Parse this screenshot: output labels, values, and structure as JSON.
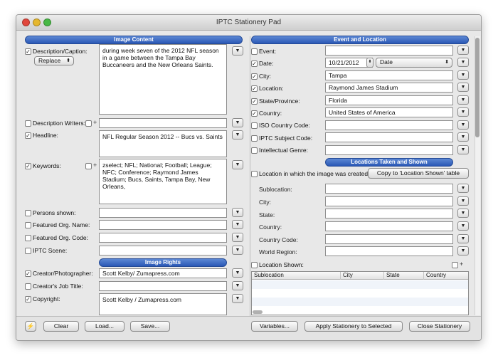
{
  "window": {
    "title": "IPTC Stationery Pad"
  },
  "left": {
    "image_content_header": "Image Content",
    "description_label": "Description/Caption:",
    "replace_popup": "Replace",
    "description_value": "during week seven of the 2012 NFL season in a game between the Tampa Bay Buccaneers and the New Orleans Saints.",
    "description_writers_label": "Description Writers:",
    "headline_label": "Headline:",
    "headline_value": "NFL Regular Season 2012 -- Bucs vs. Saints",
    "keywords_label": "Keywords:",
    "keywords_value": "zselect; NFL; National; Football; League; NFC; Conference; Raymond James Stadium; Bucs, Saints, Tampa Bay, New Orleans,",
    "persons_label": "Persons shown:",
    "featured_org_name_label": "Featured Org. Name:",
    "featured_org_code_label": "Featured Org. Code:",
    "iptc_scene_label": "IPTC Scene:",
    "image_rights_header": "Image Rights",
    "creator_label": "Creator/Photographer:",
    "creator_value": "Scott Kelby/ Zumapress.com",
    "creators_job_label": "Creator's Job Title:",
    "copyright_label": "Copyright:",
    "copyright_value": "Scott Kelby / Zumapress.com",
    "plus_sign": "+"
  },
  "right": {
    "event_header": "Event and Location",
    "event_label": "Event:",
    "date_label": "Date:",
    "date_value": "10/21/2012",
    "date_popup": "Date",
    "city_label": "City:",
    "city_value": "Tampa",
    "location_label": "Location:",
    "location_value": "Raymond James Stadium",
    "state_label": "State/Province:",
    "state_value": "Florida",
    "country_label": "Country:",
    "country_value": "United States of America",
    "iso_label": "ISO Country Code:",
    "subject_code_label": "IPTC Subject Code:",
    "genre_label": "Intellectual Genre:",
    "locations_header": "Locations Taken and Shown",
    "location_created_label": "Location in which the image was created:",
    "copy_button": "Copy to 'Location Shown' table",
    "sublocation_label": "Sublocation:",
    "city2_label": "City:",
    "state2_label": "State:",
    "country2_label": "Country:",
    "country_code_label": "Country Code:",
    "world_region_label": "World Region:",
    "location_shown_label": "Location Shown:",
    "plus_sign": "+",
    "table_columns": [
      "Sublocation",
      "City",
      "State",
      "Country"
    ]
  },
  "bottom": {
    "lightning_glyph": "⚡",
    "clear": "Clear",
    "load": "Load...",
    "save": "Save...",
    "variables": "Variables...",
    "apply": "Apply Stationery to Selected",
    "close": "Close Stationery"
  },
  "colors": {
    "section_header": "#2a58b5",
    "window_bg": "#e8e8e8"
  }
}
